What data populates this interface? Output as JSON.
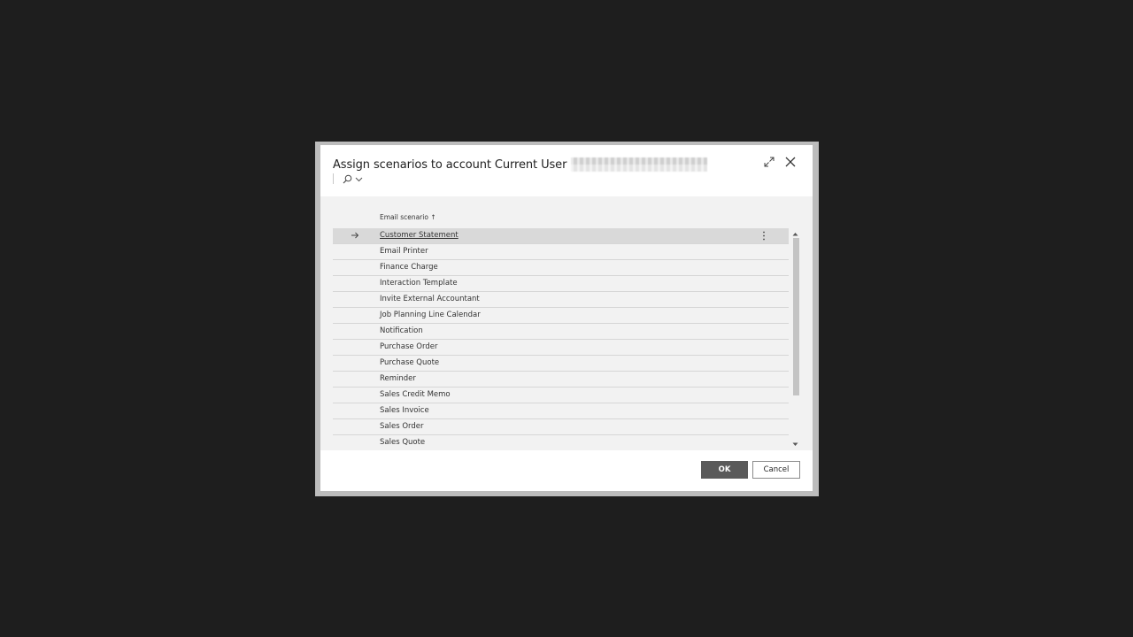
{
  "dialog": {
    "title": "Assign scenarios to account Current User",
    "expand_icon": "expand-icon",
    "close_icon": "close-icon",
    "search_icon": "search-icon"
  },
  "list": {
    "column_header": "Email scenario ↑",
    "rows": [
      "Customer Statement",
      "Email Printer",
      "Finance Charge",
      "Interaction Template",
      "Invite External Accountant",
      "Job Planning Line Calendar",
      "Notification",
      "Purchase Order",
      "Purchase Quote",
      "Reminder",
      "Sales Credit Memo",
      "Sales Invoice",
      "Sales Order",
      "Sales Quote"
    ],
    "selected_index": 0
  },
  "footer": {
    "ok_label": "OK",
    "cancel_label": "Cancel"
  },
  "colors": {
    "backdrop": "#1e1e1e",
    "content_bg": "#f2f2f2",
    "selected_row": "#d9d9d9",
    "ok_button": "#5a5a5a"
  }
}
